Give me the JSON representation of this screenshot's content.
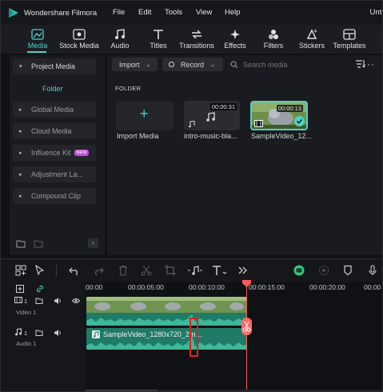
{
  "app": {
    "name": "Wondershare Filmora",
    "window_title": "Untit",
    "accent": "#4fd1c5"
  },
  "menu": [
    "File",
    "Edit",
    "Tools",
    "View",
    "Help"
  ],
  "toolbar": {
    "tabs": [
      {
        "label": "Media",
        "icon": "media-icon",
        "active": true
      },
      {
        "label": "Stock Media",
        "icon": "stock-media-icon"
      },
      {
        "label": "Audio",
        "icon": "music-note-icon"
      },
      {
        "label": "Titles",
        "icon": "text-t-icon"
      },
      {
        "label": "Transitions",
        "icon": "transition-arrows-icon"
      },
      {
        "label": "Effects",
        "icon": "sparkle-icon"
      },
      {
        "label": "Filters",
        "icon": "filters-circles-icon"
      },
      {
        "label": "Stickers",
        "icon": "sticker-icon"
      },
      {
        "label": "Templates",
        "icon": "templates-icon"
      }
    ]
  },
  "sidebar": {
    "items": [
      {
        "label": "Project Media",
        "expanded": true
      },
      {
        "label": "Global Media"
      },
      {
        "label": "Cloud Media"
      },
      {
        "label": "Influence Kit",
        "badge": "NEW"
      },
      {
        "label": "Adjustment La..."
      },
      {
        "label": "Compound Clip"
      }
    ],
    "sub_item": "Folder"
  },
  "media": {
    "import_label": "Import",
    "record_label": "Record",
    "search_placeholder": "Search media",
    "folder_heading": "FOLDER",
    "items": [
      {
        "caption": "Import Media"
      },
      {
        "caption": "intro-music-bla...",
        "duration": "00:00:31"
      },
      {
        "caption": "SampleVideo_12...",
        "duration": "00:00:13",
        "selected": true
      }
    ]
  },
  "timeline": {
    "ruler": [
      "00:00",
      "00:00:05:00",
      "00:00:10:00",
      "00:00:15:00",
      "00:00:20:00",
      "00:00"
    ],
    "tracks": [
      {
        "number": "1",
        "name": "Video 1"
      },
      {
        "number": "1",
        "name": "Audio 1"
      }
    ],
    "audio_clip_label": "SampleVideo_1280x720_2m…"
  }
}
